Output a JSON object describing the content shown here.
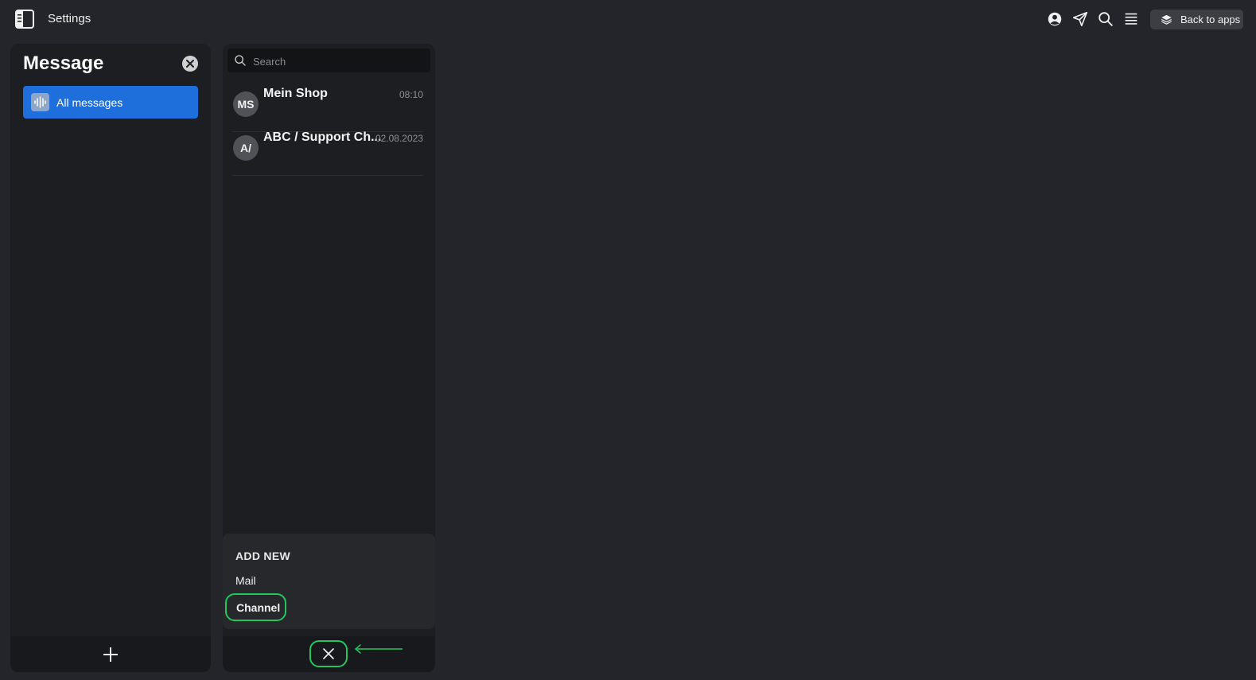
{
  "topbar": {
    "title": "Settings",
    "back_label": "Back to apps",
    "icons": [
      "user-circle-icon",
      "send-icon",
      "search-icon",
      "menu-lines-icon"
    ]
  },
  "sidebar": {
    "title": "Message",
    "items": [
      {
        "label": "All messages",
        "icon": "soundwave-icon",
        "active": true
      }
    ]
  },
  "conversations": {
    "search_placeholder": "Search",
    "items": [
      {
        "initials": "MS",
        "name": "Mein Shop",
        "time": "08:10"
      },
      {
        "initials": "A/",
        "name": "ABC / Support Ch...",
        "time": "02.08.2023"
      }
    ]
  },
  "add_menu": {
    "heading": "ADD NEW",
    "items": [
      "Mail",
      "Channel"
    ]
  },
  "colors": {
    "accent": "#1e6fdc",
    "highlight": "#22c55e",
    "background": "#23252a",
    "panel": "#1d1e21"
  }
}
